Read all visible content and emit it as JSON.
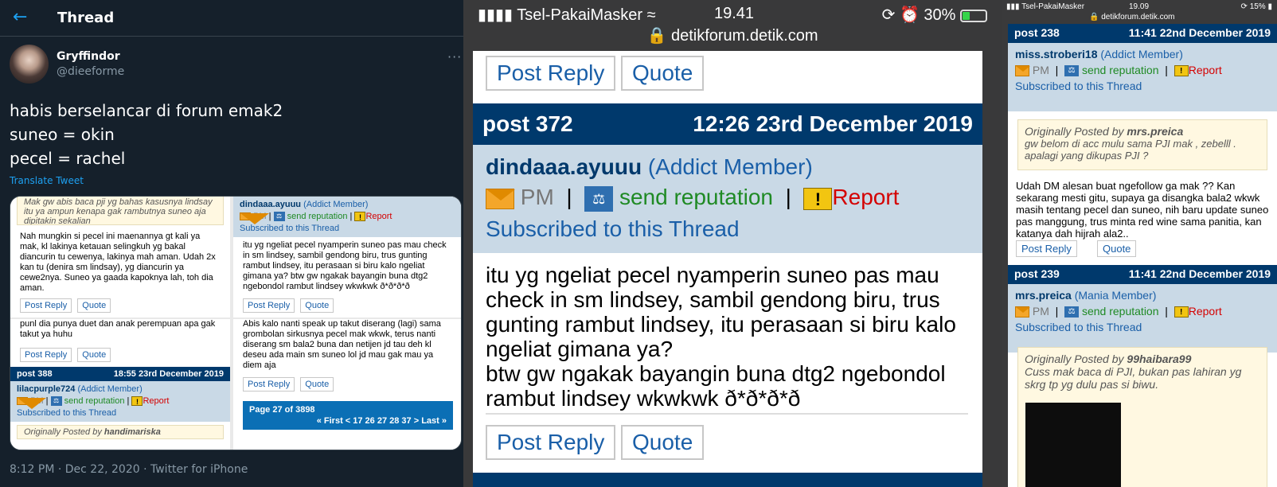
{
  "twitter": {
    "header_title": "Thread",
    "user_name": "Gryffindor",
    "user_handle": "@dieeforme",
    "tweet_lines": [
      "habis berselancar di forum emak2",
      "suneo = okin",
      "pecel = rachel"
    ],
    "translate_label": "Translate Tweet",
    "meta": "8:12 PM · Dec 22, 2020 · Twitter for iPhone",
    "media": {
      "q1_quote": "Mak gw abis baca pji yg bahas kasusnya lindsay itu ya ampun kenapa gak rambutnya suneo aja dipitakin sekalian",
      "q1_body": "Nah mungkin si pecel ini maenannya gt kali ya mak, kl lakinya ketauan selingkuh yg bakal diancurin tu cewenya, lakinya mah aman. Udah 2x kan tu (denira sm lindsay), yg diancurin ya cewe2nya. Suneo ya gaada kapoknya lah, toh dia aman.",
      "q2_user": "dindaaa.ayuuu",
      "q2_role": "(Addict Member)",
      "q2_pm": "PM",
      "q2_rep": "send reputation",
      "q2_report": "Report",
      "q2_sub": "Subscribed to this Thread",
      "q2_body": "itu yg ngeliat pecel nyamperin suneo pas mau check in sm lindsey, sambil gendong biru, trus gunting rambut lindsey, itu perasaan si biru kalo ngeliat gimana ya? btw gw ngakak bayangin buna dtg2 ngebondol rambut lindsey wkwkwk ð*ð*ð*ð",
      "q3_top": "punl dia punya duet dan anak perempuan apa gak takut ya huhu",
      "q3_post": "post 388",
      "q3_date": "18:55 23rd December 2019",
      "q3_user": "lilacpurple724",
      "q3_role": "(Addict Member)",
      "q3_pm": "PM",
      "q3_rep": "send reputation",
      "q3_report": "Report",
      "q3_sub": "Subscribed to this Thread",
      "q3_orig_label": "Originally Posted by",
      "q3_orig_user": "handimariska",
      "q4_body": "Abis kalo nanti speak up takut diserang (lagi) sama grombolan sirkusnya pecel mak wkwk, terus nanti diserang sm bala2 buna dan netijen jd tau deh kl deseu ada main sm suneo lol jd mau gak mau ya diem aja",
      "q4_pager_title": "Page 27 of 3898",
      "q4_pager_nav": "« First < 17 26   27 28 37  > Last »",
      "post_reply": "Post Reply",
      "quote": "Quote"
    }
  },
  "middle": {
    "carrier": "Tsel-PakaiMasker",
    "time": "19.41",
    "battery": "30%",
    "url": "detikforum.detik.com",
    "post_reply": "Post Reply",
    "quote": "Quote",
    "post_no": "post 372",
    "post_date": "12:26 23rd December 2019",
    "user": "dindaaa.ayuuu",
    "role": "(Addict Member)",
    "pm": "PM",
    "rep": "send reputation",
    "report": "Report",
    "subscribed": "Subscribed to this Thread",
    "message": "itu yg ngeliat pecel nyamperin suneo pas mau check in sm lindsey, sambil gendong biru, trus gunting rambut lindsey, itu perasaan si biru kalo ngeliat gimana ya?",
    "message2": "btw gw ngakak bayangin buna dtg2 ngebondol rambut lindsey wkwkwk ð*ð*ð*ð"
  },
  "right": {
    "carrier": "Tsel-PakaiMasker",
    "time": "19.09",
    "battery": "15%",
    "url": "detikforum.detik.com",
    "post1_no": "post 238",
    "post1_date": "11:41 22nd December 2019",
    "post1_user": "miss.stroberi18",
    "post1_role": "(Addict Member)",
    "pm": "PM",
    "rep": "send reputation",
    "report": "Report",
    "subscribed": "Subscribed to this Thread",
    "orig_label": "Originally Posted by",
    "post1_quote_user": "mrs.preica",
    "post1_quote": "gw belom di acc mulu sama PJI mak , zebelll . apalagi yang dikupas PJI ?",
    "post1_body": "Udah DM alesan buat ngefollow ga mak ?? Kan sekarang mesti gitu, supaya ga disangka bala2 wkwk masih tentang pecel dan suneo, nih baru update suneo pas manggung, trus minta red wine sama panitia, kan katanya dah hijrah ala2..",
    "post_reply": "Post Reply",
    "quote": "Quote",
    "post2_no": "post 239",
    "post2_date": "11:41 22nd December 2019",
    "post2_user": "mrs.preica",
    "post2_role": "(Mania Member)",
    "post2_quote_user": "99haibara99",
    "post2_quote": "Cuss mak baca di PJI, bukan pas lahiran yg skrg tp yg dulu pas si biwu."
  }
}
